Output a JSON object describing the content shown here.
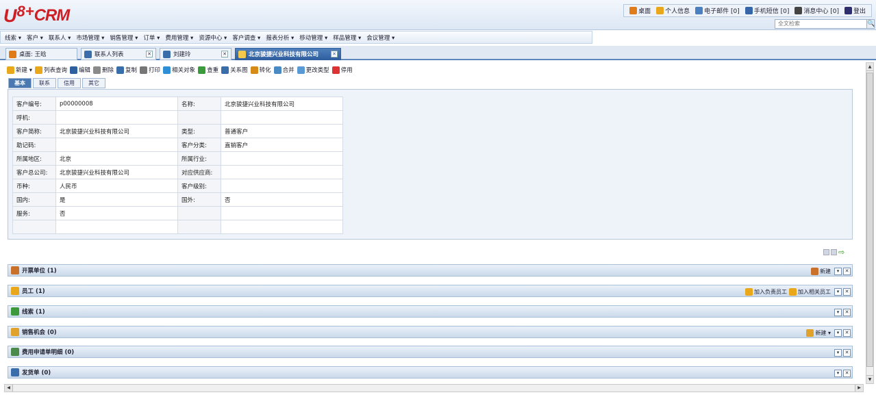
{
  "logo": {
    "part1": "U",
    "part2": "8+",
    "part3": "CRM"
  },
  "toplinks": [
    {
      "label": "桌面",
      "icon": "home-icon",
      "color": "#e07b1a"
    },
    {
      "label": "个人信息",
      "icon": "user-icon",
      "color": "#e9a81c"
    },
    {
      "label": "电子邮件 [0]",
      "icon": "mail-icon",
      "color": "#4a7fc0"
    },
    {
      "label": "手机短信 [0]",
      "icon": "phone-icon",
      "color": "#3466a8"
    },
    {
      "label": "消息中心 [0]",
      "icon": "message-icon",
      "color": "#444"
    },
    {
      "label": "登出",
      "icon": "logout-icon",
      "color": "#2e2e6e"
    }
  ],
  "search": {
    "placeholder": "全文检索",
    "button": "🔍"
  },
  "menu": [
    "线索 ▾",
    "客户 ▾",
    "联系人 ▾",
    "市场管理 ▾",
    "销售管理 ▾",
    "订单 ▾",
    "费用管理 ▾",
    "资源中心 ▾",
    "客户调查 ▾",
    "报表分析 ▾",
    "移动管理 ▾",
    "样品管理 ▾",
    "会议管理 ▾"
  ],
  "tabs": [
    {
      "label": "桌面: 王晗",
      "icon": "home-icon",
      "closable": false,
      "active": false
    },
    {
      "label": "联系人列表",
      "icon": "user-icon",
      "closable": true,
      "active": false
    },
    {
      "label": "刘建玲",
      "icon": "user-icon",
      "closable": true,
      "active": false
    },
    {
      "label": "北京骏捷兴业科技有限公司",
      "icon": "customer-icon",
      "closable": true,
      "active": true
    }
  ],
  "toolbar": [
    {
      "label": "新建 ▾",
      "icon": "new-icon",
      "color": "#e9a81c"
    },
    {
      "label": "列表查询",
      "icon": "list-query-icon",
      "color": "#e9a81c"
    },
    {
      "label": "编辑",
      "icon": "edit-icon",
      "color": "#2e5f9e"
    },
    {
      "label": "删除",
      "icon": "delete-icon",
      "color": "#8a8a8a"
    },
    {
      "label": "复制",
      "icon": "copy-icon",
      "color": "#3a6eaa"
    },
    {
      "label": "打印",
      "icon": "print-icon",
      "color": "#777"
    },
    {
      "label": "相关对象",
      "icon": "related-icon",
      "color": "#2e8fd6"
    },
    {
      "label": "查重",
      "icon": "dedupe-icon",
      "color": "#3b9a3b"
    },
    {
      "label": "关系图",
      "icon": "relation-icon",
      "color": "#3a6eaa"
    },
    {
      "label": "转化",
      "icon": "convert-icon",
      "color": "#d58b16"
    },
    {
      "label": "合并",
      "icon": "merge-icon",
      "color": "#4a8ac4"
    },
    {
      "label": "更改类型",
      "icon": "change-type-icon",
      "color": "#5a9ad4"
    },
    {
      "label": "停用",
      "icon": "disable-icon",
      "color": "#d33"
    }
  ],
  "subtabs": [
    "基本",
    "联系",
    "信用",
    "其它"
  ],
  "form": {
    "rows": [
      [
        "客户编号:",
        "p00000008",
        "名称:",
        "北京骏捷兴业科技有限公司"
      ],
      [
        "呼机:",
        "",
        "",
        ""
      ],
      [
        "客户简称:",
        "北京骏捷兴业科技有限公司",
        "类型:",
        "普通客户"
      ],
      [
        "助记码:",
        "",
        "客户分类:",
        "直销客户"
      ],
      [
        "所属地区:",
        "北京",
        "所属行业:",
        ""
      ],
      [
        "客户总公司:",
        "北京骏捷兴业科技有限公司",
        "对应供应商:",
        ""
      ],
      [
        "币种:",
        "人民币",
        "客户级别:",
        ""
      ],
      [
        "国内:",
        "是",
        "国外:",
        "否"
      ],
      [
        "服务:",
        "否",
        "",
        ""
      ],
      [
        "",
        "",
        "",
        ""
      ]
    ]
  },
  "sections": [
    {
      "title": "开票单位 (1)",
      "icon": "invoice-unit-icon",
      "color": "#c9702a",
      "actions": [
        {
          "label": "新建",
          "icon": "new-icon",
          "color": "#c9702a"
        }
      ]
    },
    {
      "title": "员工 (1)",
      "icon": "employee-icon",
      "color": "#e9a81c",
      "actions": [
        {
          "label": "加入负责员工",
          "icon": "add-owner-icon",
          "color": "#e9a81c"
        },
        {
          "label": "加入相关员工",
          "icon": "add-related-icon",
          "color": "#e9a81c"
        }
      ]
    },
    {
      "title": "线索 (1)",
      "icon": "lead-icon",
      "color": "#3c9a3c",
      "actions": []
    },
    {
      "title": "销售机会 (0)",
      "icon": "opportunity-icon",
      "color": "#e0a22a",
      "actions": [
        {
          "label": "新建 ▾",
          "icon": "new-icon",
          "color": "#e0a22a"
        }
      ]
    },
    {
      "title": "费用申请单明细 (0)",
      "icon": "expense-icon",
      "color": "#4a8a4a",
      "actions": []
    },
    {
      "title": "发货单 (0)",
      "icon": "delivery-icon",
      "color": "#3a6eaa",
      "actions": []
    }
  ],
  "controls": {
    "collapse": "▾",
    "close": "✕",
    "arrow": "⇨"
  }
}
